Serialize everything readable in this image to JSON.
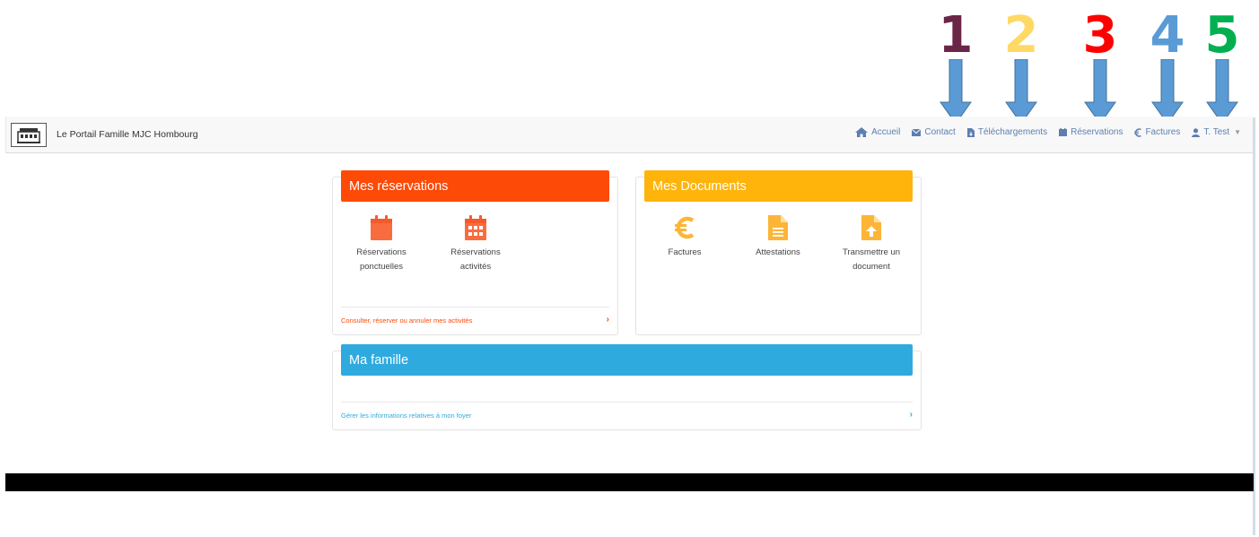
{
  "annotations": [
    "1",
    "2",
    "3",
    "4",
    "5"
  ],
  "annotation_colors": {
    "1": "#6a2647",
    "2": "#ffd966",
    "3": "#ff0000",
    "4": "#5b9bd5",
    "5": "#00b050",
    "arrow": "#5b9bd5"
  },
  "app": {
    "title": "Le Portail Famille MJC Hombourg"
  },
  "nav": {
    "accueil": "Accueil",
    "contact": "Contact",
    "telechargements": "Téléchargements",
    "reservations": "Réservations",
    "factures": "Factures",
    "user": "T. Test"
  },
  "cards": {
    "reservations": {
      "title": "Mes réservations",
      "color": "#fe4a07",
      "tiles": [
        {
          "line1": "Réservations",
          "line2": "ponctuelles"
        },
        {
          "line1": "Réservations",
          "line2": "activités"
        }
      ],
      "footer": "Consulter, réserver ou annuler mes activités"
    },
    "documents": {
      "title": "Mes Documents",
      "color": "#feb40b",
      "tiles": [
        {
          "line1": "Factures",
          "line2": ""
        },
        {
          "line1": "Attestations",
          "line2": ""
        },
        {
          "line1": "Transmettre un",
          "line2": "document"
        }
      ]
    },
    "famille": {
      "title": "Ma famille",
      "color": "#2faadf",
      "footer": "Gérer les informations relatives à mon foyer"
    }
  }
}
